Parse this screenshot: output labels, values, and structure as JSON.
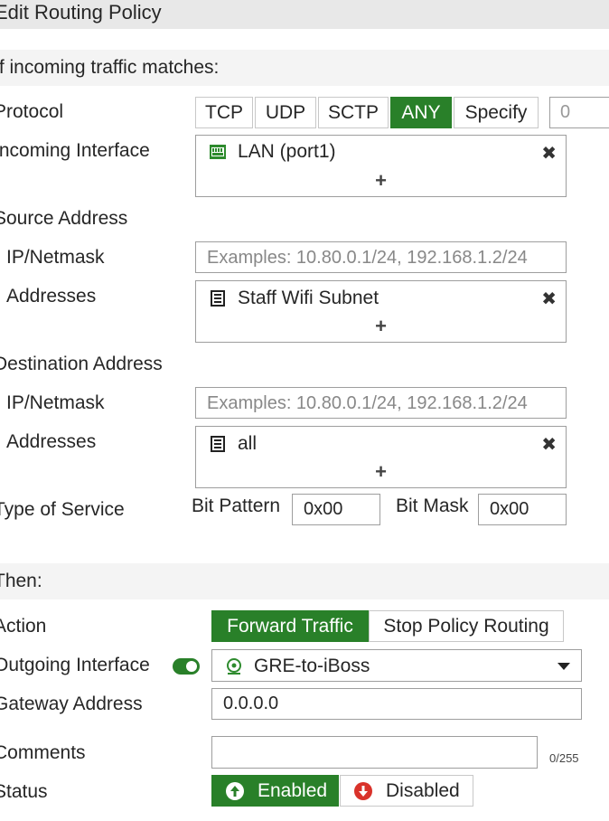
{
  "header": {
    "title": "Edit Routing Policy"
  },
  "section_match": {
    "title": "If incoming traffic matches:"
  },
  "protocol": {
    "label": "Protocol",
    "options": [
      "TCP",
      "UDP",
      "SCTP",
      "ANY",
      "Specify"
    ],
    "selected": "ANY",
    "specify_value": "0"
  },
  "incoming_interface": {
    "label": "Incoming Interface",
    "value": "LAN (port1)",
    "icon": "network-port-icon",
    "add": "+",
    "remove": "✖"
  },
  "source": {
    "label": "Source Address",
    "ip_label": "IP/Netmask",
    "ip_placeholder": "Examples: 10.80.0.1/24, 192.168.1.2/24",
    "addr_label": "Addresses",
    "addr_value": "Staff Wifi Subnet",
    "add": "+",
    "remove": "✖"
  },
  "destination": {
    "label": "Destination Address",
    "ip_label": "IP/Netmask",
    "ip_placeholder": "Examples: 10.80.0.1/24, 192.168.1.2/24",
    "addr_label": "Addresses",
    "addr_value": "all",
    "add": "+",
    "remove": "✖"
  },
  "tos": {
    "label": "Type of Service",
    "bit_pattern_label": "Bit Pattern",
    "bit_pattern_value": "0x00",
    "bit_mask_label": "Bit Mask",
    "bit_mask_value": "0x00"
  },
  "section_then": {
    "title": "Then:"
  },
  "action": {
    "label": "Action",
    "options": [
      "Forward Traffic",
      "Stop Policy Routing"
    ],
    "selected": "Forward Traffic"
  },
  "outgoing_interface": {
    "label": "Outgoing Interface",
    "enabled": true,
    "value": "GRE-to-iBoss",
    "icon": "tunnel-interface-icon"
  },
  "gateway": {
    "label": "Gateway Address",
    "value": "0.0.0.0"
  },
  "comments": {
    "label": "Comments",
    "value": "",
    "counter": "0/255"
  },
  "status": {
    "label": "Status",
    "enabled_label": "Enabled",
    "disabled_label": "Disabled",
    "selected": "Enabled"
  },
  "colors": {
    "accent": "#298029",
    "section_bg": "#f4f4f4",
    "header_bg": "#e8e8e8"
  }
}
